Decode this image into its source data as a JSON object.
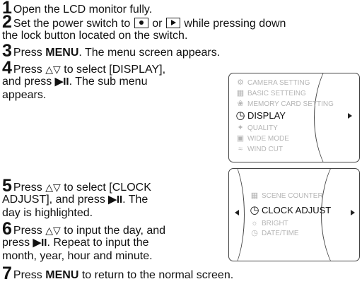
{
  "steps": [
    {
      "number": "1",
      "line1": "Open the LCD monitor fully."
    },
    {
      "number": "2",
      "line1_a": "Set the power switch to",
      "or": "or",
      "line1_b": "while pressing down",
      "line2": "the lock button located on the switch."
    },
    {
      "number": "3",
      "pre": "Press",
      "bold": "MENU",
      "post": ". The menu screen appears."
    },
    {
      "number": "4",
      "line1_pre": "Press",
      "arrows": "△▽",
      "line1_post": "to select [DISPLAY],",
      "line2_pre": "and press",
      "playpause": "▶II",
      "line2_post": ". The sub menu",
      "line3": "appears."
    },
    {
      "number": "5",
      "line1_pre": "Press",
      "arrows": "△▽",
      "line1_post": "to select [CLOCK",
      "line2_pre": "ADJUST], and press",
      "playpause": "▶II",
      "line2_post": ". The",
      "line3": "day is highlighted."
    },
    {
      "number": "6",
      "line1_pre": "Press",
      "arrows": "△▽",
      "line1_post": "to input the day, and",
      "line2_pre": "press",
      "playpause": "▶II",
      "line2_post": ". Repeat to input the",
      "line3": "month, year, hour and minute."
    },
    {
      "number": "7",
      "pre": "Press",
      "bold": "MENU",
      "post": "to return to the normal screen."
    }
  ],
  "menu_screen": {
    "items": [
      {
        "label": "CAMERA SETTING",
        "icon": "camera-setting-icon"
      },
      {
        "label": "BASIC SETTEING",
        "icon": "basic-setting-icon"
      },
      {
        "label": "MEMORY CARD SETTING",
        "icon": "memory-card-icon"
      },
      {
        "label": "DISPLAY",
        "icon": "clock-icon",
        "selected": true
      },
      {
        "label": "QUALITY",
        "icon": "quality-icon"
      },
      {
        "label": "WIDE MODE",
        "icon": "wide-mode-icon"
      },
      {
        "label": "WIND CUT",
        "icon": "wind-cut-icon"
      }
    ]
  },
  "sub_menu_screen": {
    "items": [
      {
        "label": "SCENE COUNTER",
        "icon": "scene-counter-icon"
      },
      {
        "label": "CLOCK ADJUST",
        "icon": "clock-adjust-icon",
        "selected": true
      },
      {
        "label": "BRIGHT",
        "icon": "bright-icon"
      },
      {
        "label": "DATE/TIME",
        "icon": "date-time-icon"
      }
    ]
  }
}
